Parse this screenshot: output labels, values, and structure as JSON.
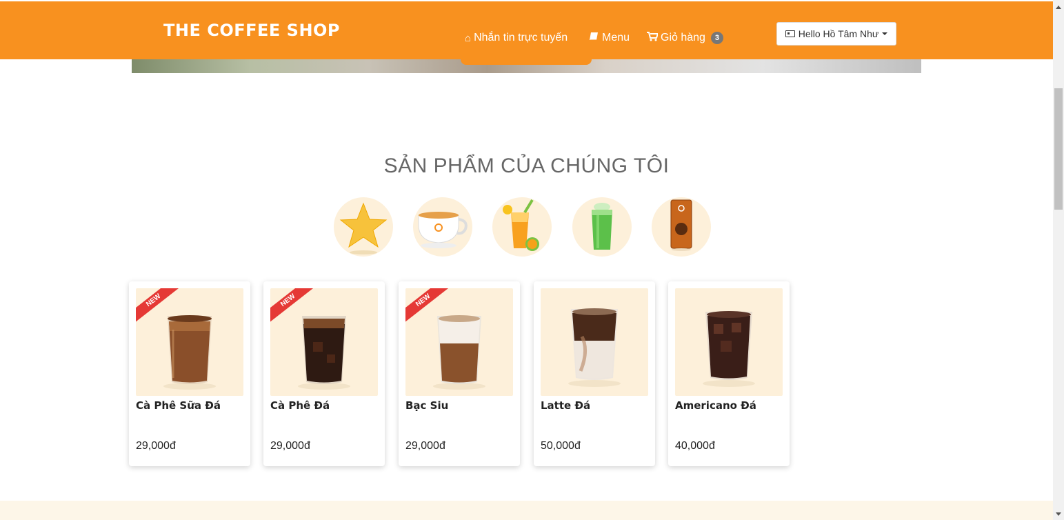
{
  "brand": "THE COFFEE SHOP",
  "nav": {
    "chat_label": "Nhắn tin trực tuyến",
    "menu_label": "Menu",
    "cart_label": "Giỏ hàng",
    "cart_count": "3",
    "user_label": "Hello Hồ Tâm Như"
  },
  "section_title": "SẢN PHẨM CỦA CHÚNG TÔI",
  "categories": [
    {
      "icon": "star-icon"
    },
    {
      "icon": "hot-coffee-cup-icon"
    },
    {
      "icon": "juice-icon"
    },
    {
      "icon": "green-drink-icon"
    },
    {
      "icon": "coffee-package-icon"
    }
  ],
  "products": [
    {
      "name": "Cà Phê Sữa Đá",
      "price": "29,000đ",
      "badge": "NEW"
    },
    {
      "name": "Cà Phê Đá",
      "price": "29,000đ",
      "badge": "NEW"
    },
    {
      "name": "Bạc Siu",
      "price": "29,000đ",
      "badge": "NEW"
    },
    {
      "name": "Latte Đá",
      "price": "50,000đ"
    },
    {
      "name": "Americano Đá",
      "price": "40,000đ"
    }
  ],
  "colors": {
    "accent": "#f8911f",
    "card_bg": "#fdf0da",
    "badge": "#e53935"
  }
}
